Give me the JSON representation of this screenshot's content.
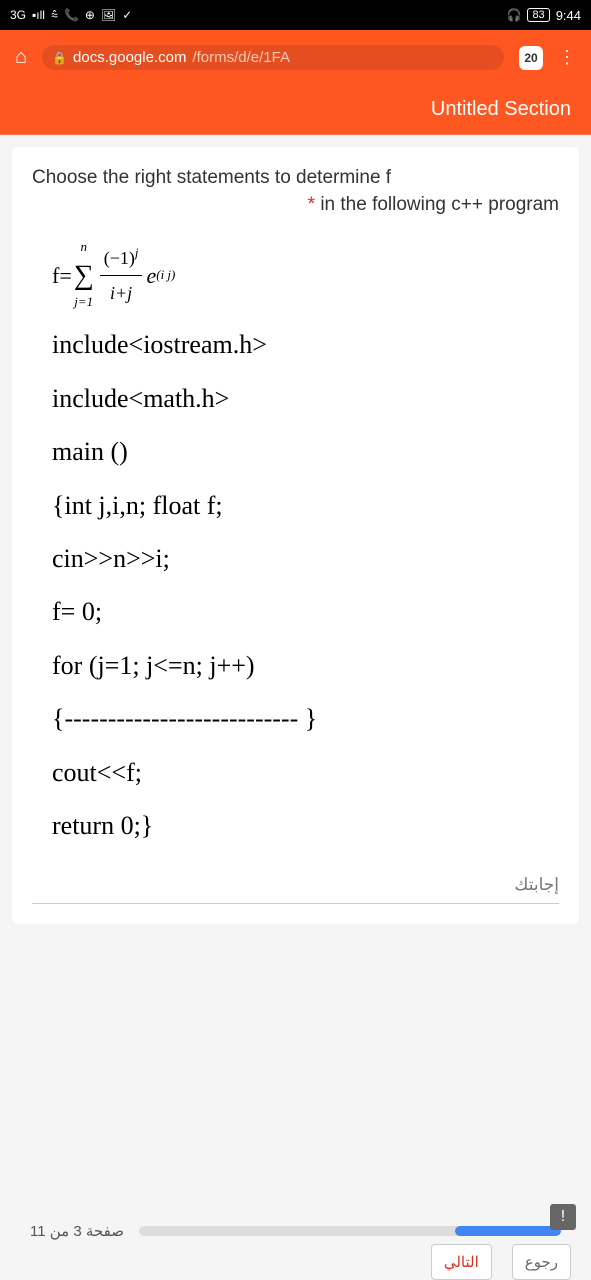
{
  "status": {
    "network": "3G",
    "signal": "▪ıll",
    "wifi": "⩯",
    "phone": "📞",
    "plus": "⊕",
    "gallery": "🖼",
    "check": "✓",
    "headphones": "🎧",
    "battery": "83",
    "time": "9:44"
  },
  "browser": {
    "url_domain": "docs.google.com",
    "url_path": "/forms/d/e/1FA",
    "tab_count": "20"
  },
  "section": {
    "title": "Untitled Section"
  },
  "question": {
    "line1": "Choose the right statements to determine f",
    "line2": "in the following c++ program",
    "required": "*"
  },
  "formula": {
    "prefix": "f= ",
    "sum_top": "n",
    "sum_bottom": "j=1",
    "frac_top_base": "(−1)",
    "frac_top_exp": "j",
    "frac_bottom": "i+j",
    "exp_base": " e",
    "exp_paren": "(i j)"
  },
  "code": {
    "line1": "include<iostream.h>",
    "line2": "include<math.h>",
    "line3": "main ()",
    "line4": "{int j,i,n; float f;",
    "line5": "cin>>n>>i;",
    "line6": "f= 0;",
    "line7": "for (j=1; j<=n; j++)",
    "line8": "{--------------------------- }",
    "line9": "cout<<f;",
    "line10": "return 0;}"
  },
  "answer": {
    "label": "إجابتك"
  },
  "footer": {
    "page_text": "صفحة 3 من 11",
    "next": "التالي",
    "back": "رجوع"
  }
}
